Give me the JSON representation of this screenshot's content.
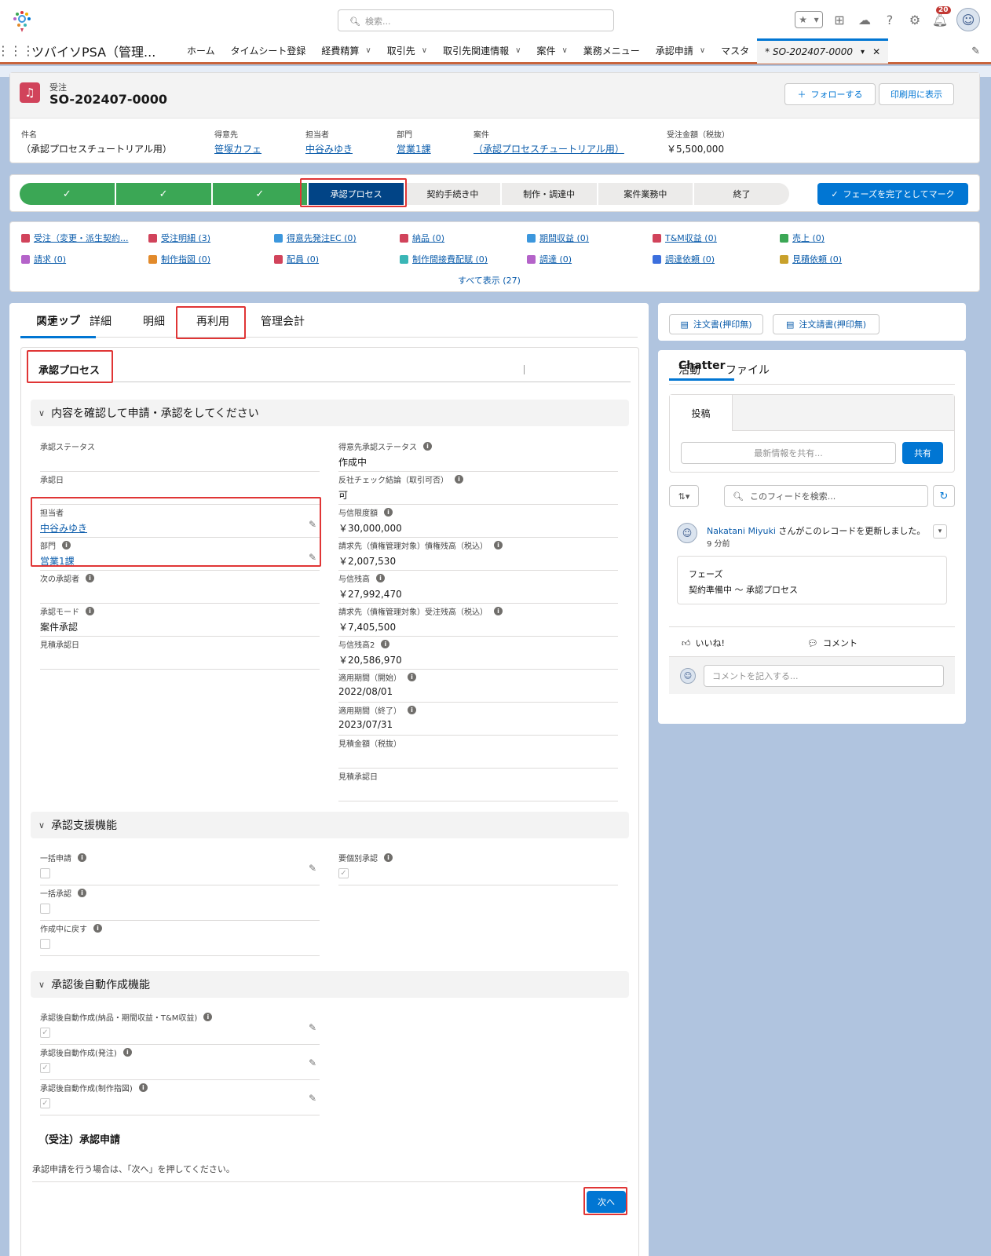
{
  "global": {
    "search_placeholder": "検索...",
    "notification_count": "20"
  },
  "nav": {
    "app_name": "ツバイソPSA（管理...",
    "items": [
      {
        "label": "ホーム",
        "dropdown": false
      },
      {
        "label": "タイムシート登録",
        "dropdown": false
      },
      {
        "label": "経費精算",
        "dropdown": true
      },
      {
        "label": "取引先",
        "dropdown": true
      },
      {
        "label": "取引先関連情報",
        "dropdown": true
      },
      {
        "label": "案件",
        "dropdown": true
      },
      {
        "label": "業務メニュー",
        "dropdown": false
      },
      {
        "label": "承認申請",
        "dropdown": true
      },
      {
        "label": "マスタ",
        "dropdown": false
      }
    ],
    "active_tab": "* SO-202407-0000"
  },
  "record": {
    "object_label": "受注",
    "name": "SO-202407-0000",
    "follow_button": "フォローする",
    "print_button": "印刷用に表示",
    "highlights": [
      {
        "label": "件名",
        "value": "（承認プロセスチュートリアル用）",
        "link": false
      },
      {
        "label": "得意先",
        "value": "笹塚カフェ",
        "link": true
      },
      {
        "label": "担当者",
        "value": "中谷みゆき",
        "link": true
      },
      {
        "label": "部門",
        "value": "営業1課",
        "link": true
      },
      {
        "label": "案件",
        "value": "（承認プロセスチュートリアル用）",
        "link": true
      },
      {
        "label": "受注金額（税抜）",
        "value": "￥5,500,000",
        "link": false
      }
    ]
  },
  "path": {
    "stages": [
      {
        "label": "✓",
        "state": "done"
      },
      {
        "label": "✓",
        "state": "done"
      },
      {
        "label": "✓",
        "state": "done"
      },
      {
        "label": "承認プロセス",
        "state": "current"
      },
      {
        "label": "契約手続き中",
        "state": "todo"
      },
      {
        "label": "制作・調達中",
        "state": "todo"
      },
      {
        "label": "案件業務中",
        "state": "todo"
      },
      {
        "label": "終了",
        "state": "todo"
      }
    ],
    "mark_button": "フェーズを完了としてマーク"
  },
  "related_links": [
    {
      "label": "受注（変更・派生契約...",
      "color": "#d1435b"
    },
    {
      "label": "受注明細 (3)",
      "color": "#d1435b"
    },
    {
      "label": "得意先発注EC (0)",
      "color": "#3c97dd"
    },
    {
      "label": "納品 (0)",
      "color": "#d1435b"
    },
    {
      "label": "期間収益 (0)",
      "color": "#3c97dd"
    },
    {
      "label": "T&M収益 (0)",
      "color": "#d1435b"
    },
    {
      "label": "売上 (0)",
      "color": "#3ba755"
    },
    {
      "label": "請求 (0)",
      "color": "#b463c9"
    },
    {
      "label": "制作指図 (0)",
      "color": "#e28a2b"
    },
    {
      "label": "配員 (0)",
      "color": "#d1435b"
    },
    {
      "label": "制作間接費配賦 (0)",
      "color": "#3ab6b6"
    },
    {
      "label": "調達 (0)",
      "color": "#b463c9"
    },
    {
      "label": "調達依頼 (0)",
      "color": "#3c6fdd"
    },
    {
      "label": "見積依頼 (0)",
      "color": "#c9a12b"
    }
  ],
  "show_all": "すべて表示 (27)",
  "tabs": [
    "関連",
    "詳細",
    "明細",
    "ステップ",
    "再利用",
    "管理会計"
  ],
  "active_tab_index": 3,
  "step": {
    "title": "承認プロセス",
    "section1": "内容を確認して申請・承認をしてください",
    "left_fields": [
      {
        "label": "承認ステータス",
        "value": "",
        "info": false,
        "link": false,
        "edit": false
      },
      {
        "label": "承認日",
        "value": "",
        "info": false,
        "link": false,
        "edit": false
      },
      {
        "label": "担当者",
        "value": "中谷みゆき",
        "info": false,
        "link": true,
        "edit": true
      },
      {
        "label": "部門",
        "value": "営業1課",
        "info": true,
        "link": true,
        "edit": true
      },
      {
        "label": "次の承認者",
        "value": "",
        "info": true,
        "link": false,
        "edit": false
      },
      {
        "label": "承認モード",
        "value": "案件承認",
        "info": true,
        "link": false,
        "edit": false
      },
      {
        "label": "見積承認日",
        "value": "",
        "info": false,
        "link": false,
        "edit": false
      }
    ],
    "right_fields": [
      {
        "label": "得意先承認ステータス",
        "value": "作成中",
        "info": true
      },
      {
        "label": "反社チェック結論（取引可否）",
        "value": "可",
        "info": true
      },
      {
        "label": "与信限度額",
        "value": "￥30,000,000",
        "info": true
      },
      {
        "label": "請求先（債権管理対象）債権残高（税込）",
        "value": "￥2,007,530",
        "info": true
      },
      {
        "label": "与信残高",
        "value": "￥27,992,470",
        "info": true
      },
      {
        "label": "請求先（債権管理対象）受注残高（税込）",
        "value": "￥7,405,500",
        "info": true
      },
      {
        "label": "与信残高2",
        "value": "￥20,586,970",
        "info": true
      },
      {
        "label": "適用期間（開始）",
        "value": "2022/08/01",
        "info": true
      },
      {
        "label": "適用期間（終了）",
        "value": "2023/07/31",
        "info": true
      },
      {
        "label": "見積金額（税抜）",
        "value": "",
        "info": false
      },
      {
        "label": "見積承認日",
        "value": "",
        "info": false
      }
    ],
    "section2": "承認支援機能",
    "support_left": [
      {
        "label": "一括申請",
        "checked": false,
        "edit": true
      },
      {
        "label": "一括承認",
        "checked": false,
        "edit": false
      },
      {
        "label": "作成中に戻す",
        "checked": false,
        "edit": false
      }
    ],
    "support_right": [
      {
        "label": "要個別承認",
        "checked": true
      }
    ],
    "section3": "承認後自動作成機能",
    "auto_fields": [
      {
        "label": "承認後自動作成(納品・期間収益・T&M収益)",
        "checked": true
      },
      {
        "label": "承認後自動作成(発注)",
        "checked": true
      },
      {
        "label": "承認後自動作成(制作指図)",
        "checked": true
      }
    ],
    "flow_title": "（受注）承認申請",
    "flow_note": "承認申請を行う場合は、「次へ」を押してください。",
    "next_button": "次へ"
  },
  "right": {
    "btn1": "注文書(押印無)",
    "btn2": "注文請書(押印無)",
    "feed_tabs": [
      "活動",
      "Chatter",
      "ファイル"
    ],
    "feed_active": 1,
    "post_tab": "投稿",
    "share_placeholder": "最新情報を共有...",
    "share_button": "共有",
    "feed_search_placeholder": "このフィードを検索...",
    "post_author": "Nakatani Miyuki",
    "post_text": "さんがこのレコードを更新しました。",
    "post_time": "9 分前",
    "change_field": "フェーズ",
    "change_value": "契約準備中 〜 承認プロセス",
    "like": "いいね!",
    "comment": "コメント",
    "comment_placeholder": "コメントを記入する..."
  }
}
